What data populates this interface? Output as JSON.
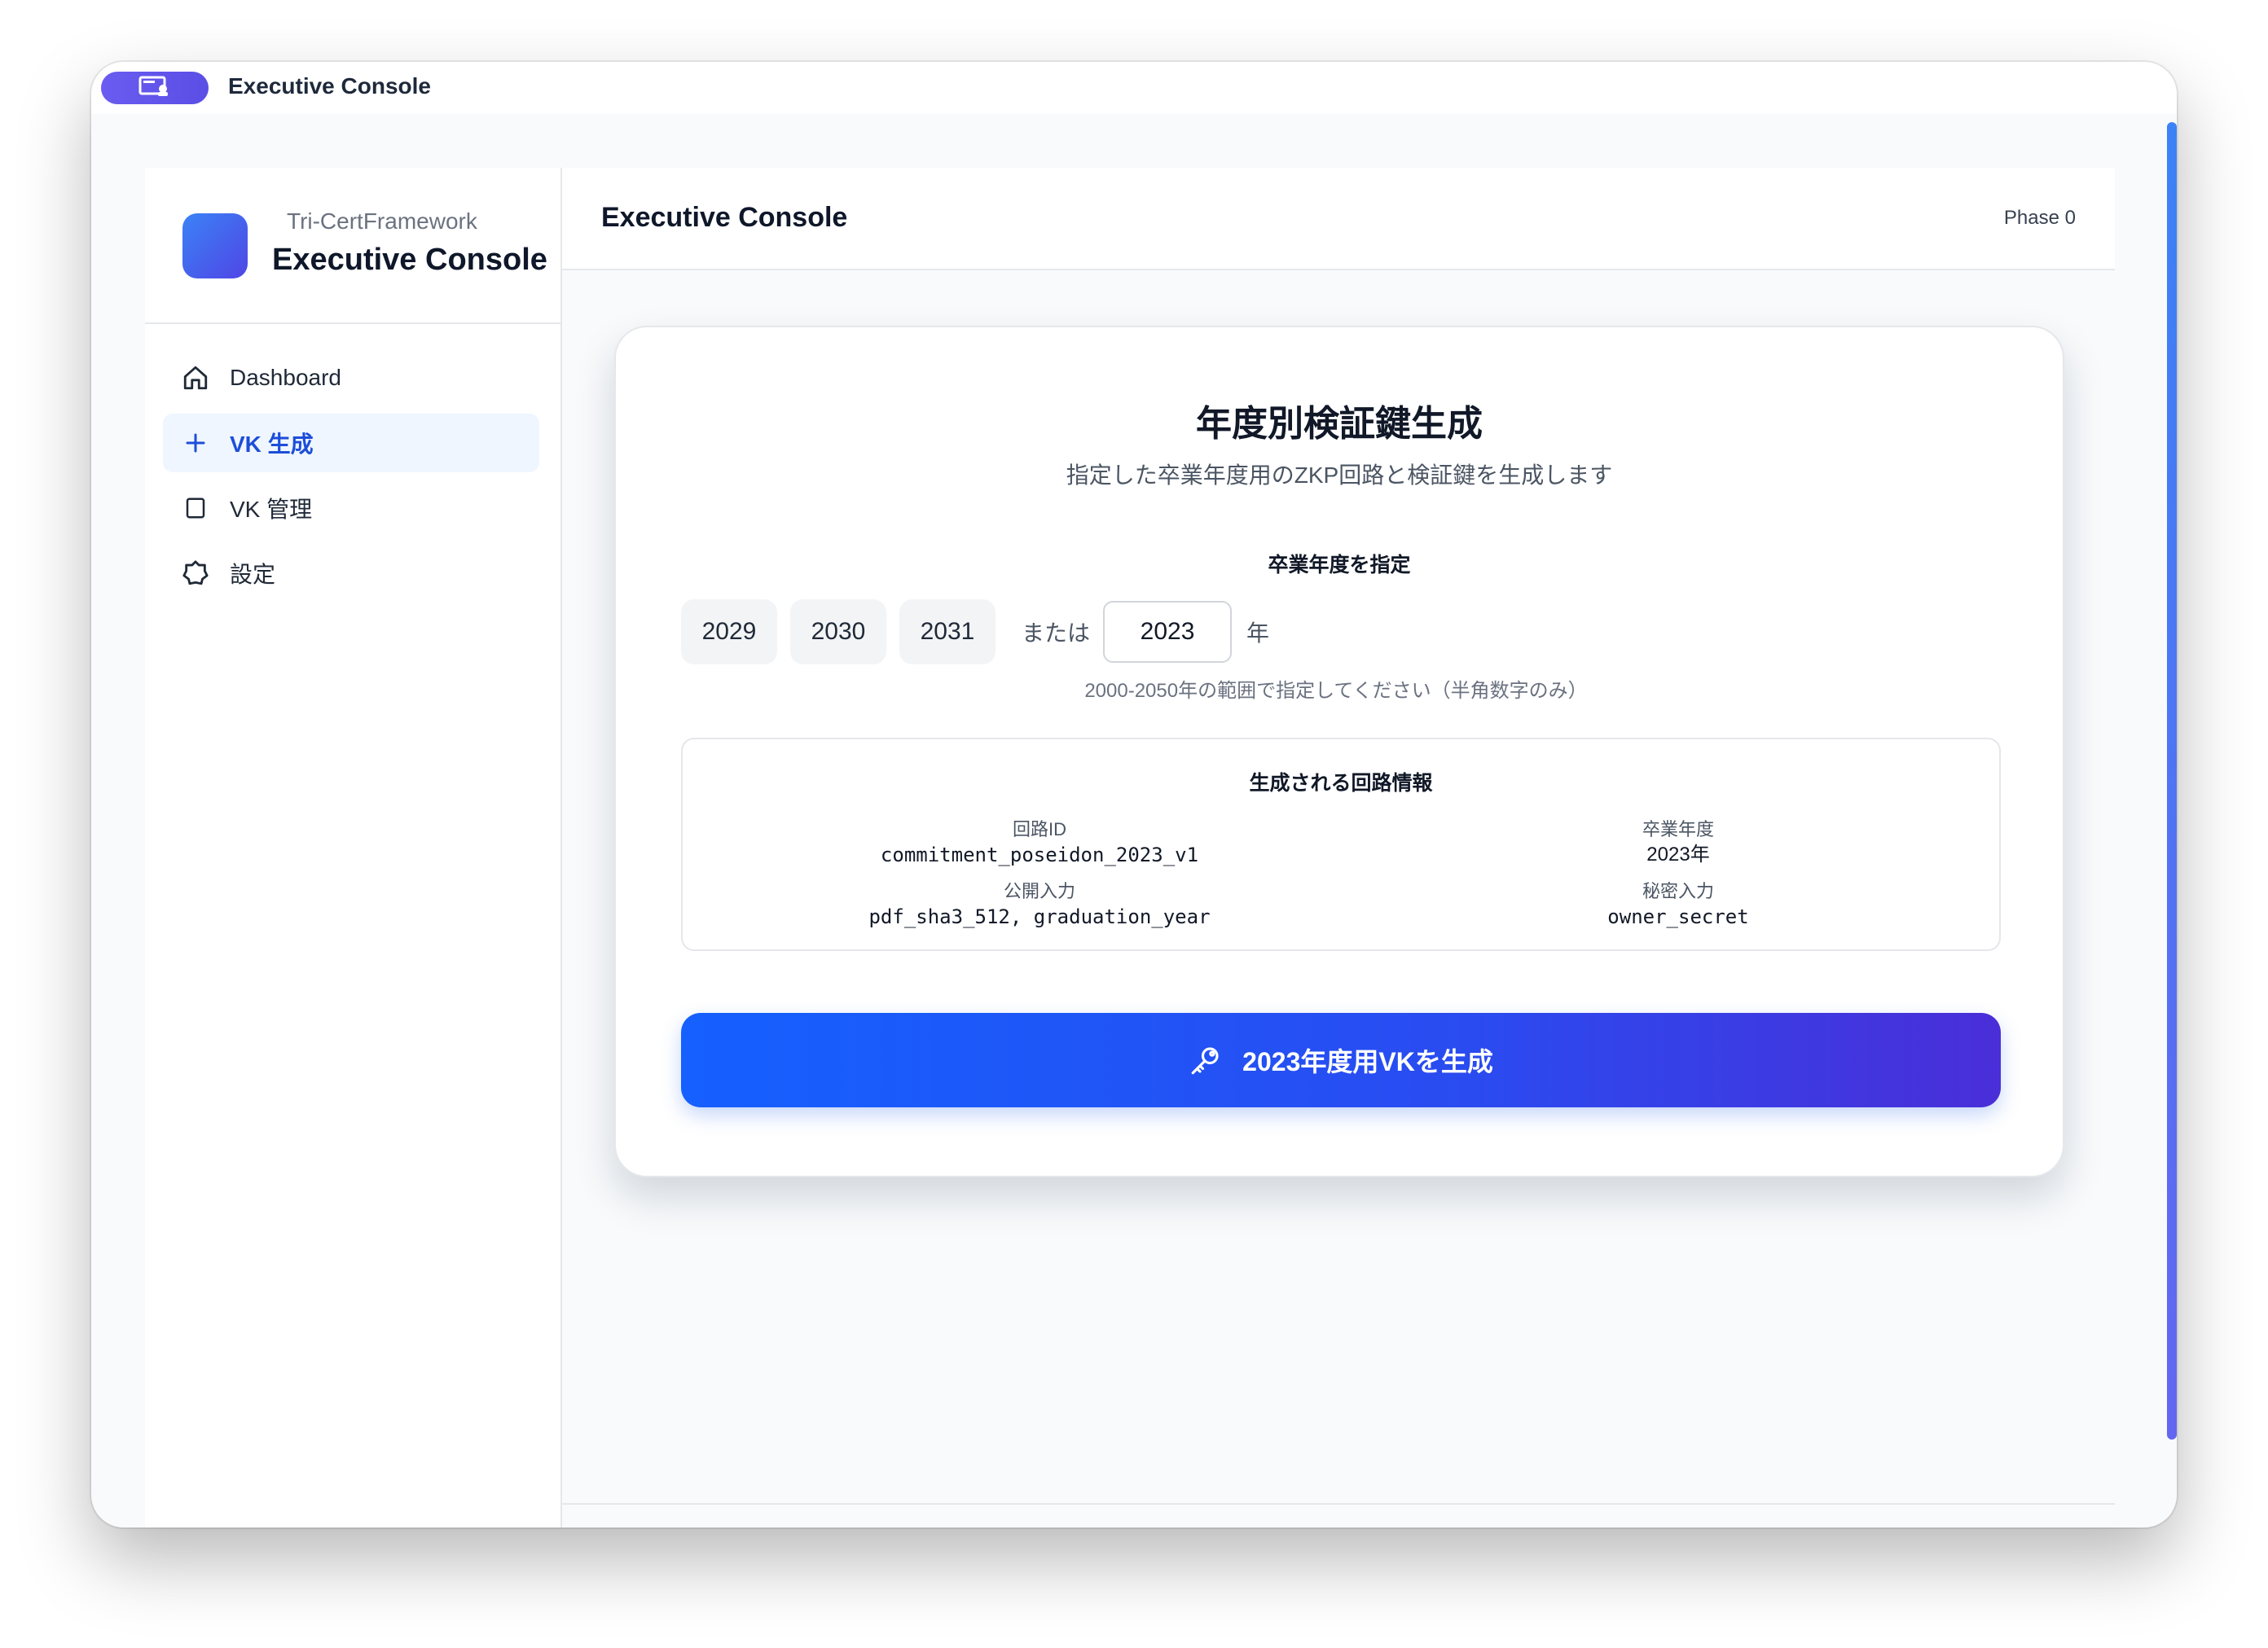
{
  "window": {
    "title": "Executive Console",
    "app_icon": "app-window-icon"
  },
  "sidebar": {
    "brand_sub": "Tri-CertFramework",
    "brand_title": "Executive Console",
    "items": [
      {
        "label": "Dashboard",
        "icon": "home-icon",
        "active": false
      },
      {
        "label": "VK 生成",
        "icon": "plus-icon",
        "active": true
      },
      {
        "label": "VK 管理",
        "icon": "square-icon",
        "active": false
      },
      {
        "label": "設定",
        "icon": "gear-icon",
        "active": false
      }
    ]
  },
  "header": {
    "title": "Executive Console",
    "phase": "Phase 0"
  },
  "card": {
    "title": "年度別検証鍵生成",
    "subtitle": "指定した卒業年度用のZKP回路と検証鍵を生成します",
    "year_label": "卒業年度を指定",
    "year_options": [
      "2029",
      "2030",
      "2031"
    ],
    "or_text": "または",
    "year_value": "2023",
    "year_suffix": "年",
    "hint": "2000-2050年の範囲で指定してください（半角数字のみ）",
    "info": {
      "title": "生成される回路情報",
      "circuit_id_label": "回路ID",
      "circuit_id": "commitment_poseidon_2023_v1",
      "grad_year_label": "卒業年度",
      "grad_year": "2023年",
      "public_input_label": "公開入力",
      "public_input": "pdf_sha3_512, graduation_year",
      "secret_input_label": "秘密入力",
      "secret_input": "owner_secret"
    },
    "generate_button": "2023年度用VKを生成"
  },
  "colors": {
    "accent": "#1d4ed8",
    "button_start": "#1560ff",
    "button_end": "#4a2ed8",
    "active_bg": "#eff6ff"
  }
}
